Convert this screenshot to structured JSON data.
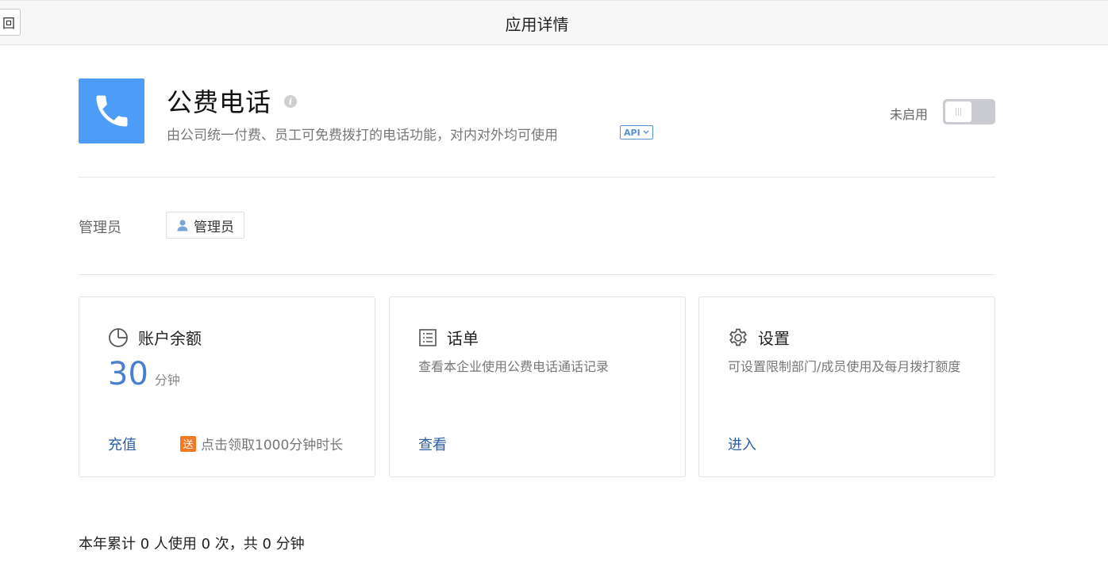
{
  "header": {
    "back_label": "回",
    "title": "应用详情"
  },
  "app": {
    "name": "公费电话",
    "description": "由公司统一付费、员工可免费拨打的电话功能，对内对外均可使用",
    "api_label": "API",
    "status_label": "未启用",
    "enabled": false,
    "icon_color": "#4d9cf8",
    "icons": {
      "app": "phone-icon",
      "info": "info-icon",
      "api_dropdown": "chevron-down-icon"
    }
  },
  "admin": {
    "label": "管理员",
    "chip_label": "管理员",
    "chip_icon": "user-icon"
  },
  "cards": {
    "balance": {
      "title": "账户余额",
      "icon": "pie-clock-icon",
      "value": "30",
      "unit": "分钟",
      "link": "充值",
      "promo_badge": "送",
      "promo_text": "点击领取1000分钟时长"
    },
    "bill": {
      "title": "话单",
      "icon": "list-icon",
      "description": "查看本企业使用公费电话通话记录",
      "link": "查看"
    },
    "settings": {
      "title": "设置",
      "icon": "gear-icon",
      "description": "可设置限制部门/成员使用及每月拨打额度",
      "link": "进入"
    }
  },
  "summary": "本年累计 0 人使用 0 次，共 0 分钟",
  "colors": {
    "accent": "#4a7fce",
    "link": "#2e5e9e",
    "promo": "#f47920"
  }
}
